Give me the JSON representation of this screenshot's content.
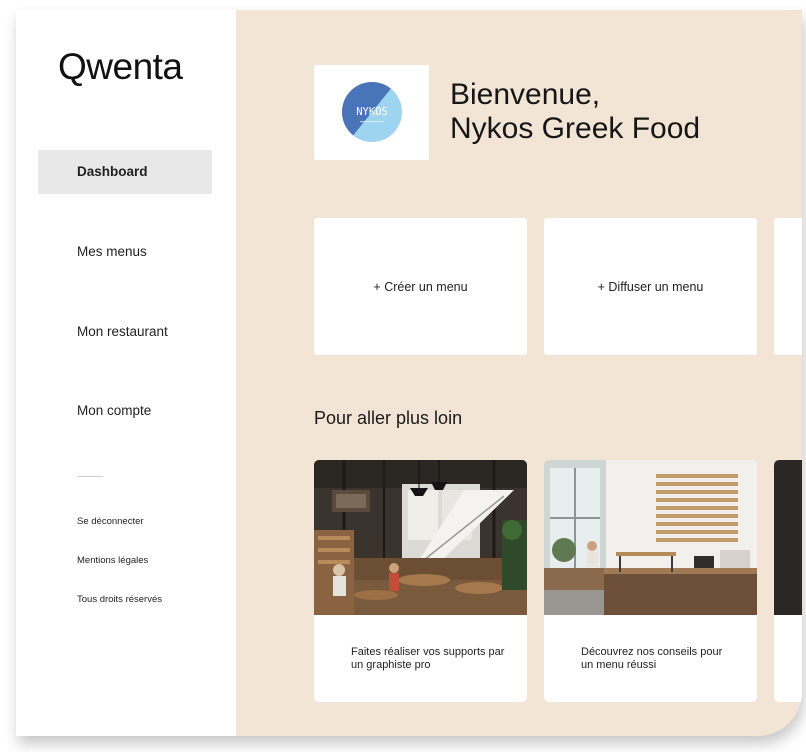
{
  "app": {
    "logo": "Qwenta"
  },
  "sidebar": {
    "items": [
      {
        "label": "Dashboard",
        "active": true
      },
      {
        "label": "Mes menus",
        "active": false
      },
      {
        "label": "Mon restaurant",
        "active": false
      },
      {
        "label": "Mon compte",
        "active": false
      }
    ],
    "footer_links": [
      {
        "label": "Se déconnecter"
      },
      {
        "label": "Mentions légales"
      },
      {
        "label": "Tous droits réservés"
      }
    ]
  },
  "header": {
    "brand_logo_text": "NYKOS",
    "welcome_line1": "Bienvenue,",
    "welcome_line2": "Nykos Greek Food"
  },
  "actions": [
    {
      "label": "+ Créer un menu"
    },
    {
      "label": "+ Diffuser un menu"
    }
  ],
  "section": {
    "title": "Pour aller plus loin"
  },
  "cards": [
    {
      "caption": "Faites réaliser vos supports par un graphiste pro",
      "image": "restaurant-interior-photo"
    },
    {
      "caption": "Découvrez nos conseils pour un menu réussi",
      "image": "cafe-counter-photo"
    }
  ],
  "colors": {
    "background": "#f2e5d6",
    "sidebar": "#ffffff",
    "active_item": "#e8e8e8",
    "brand_blue": "#4a74b8",
    "brand_light_blue": "#9ed4f0"
  }
}
